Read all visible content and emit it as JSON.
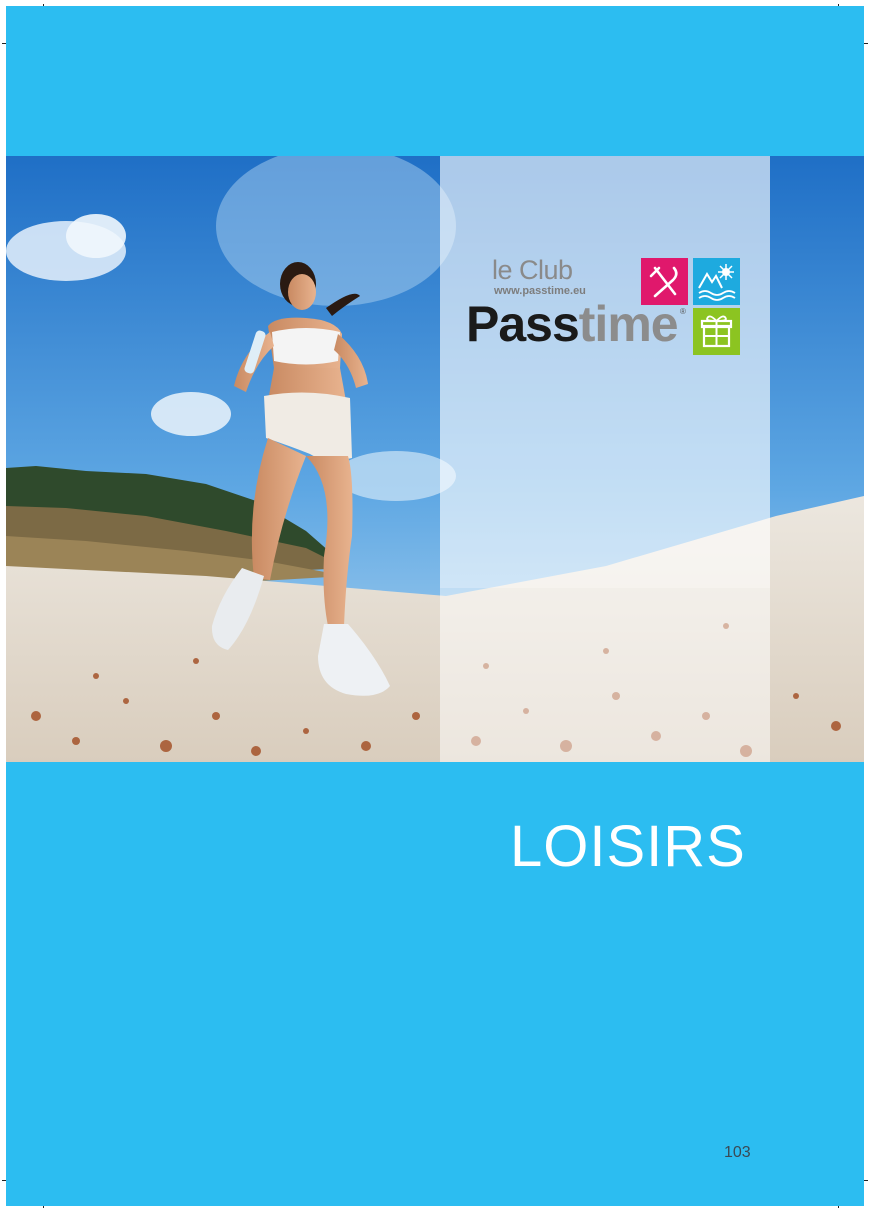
{
  "logo": {
    "prefix": "le Club",
    "website": "www.passtime.eu",
    "brand_dark": "Pass",
    "brand_light": "time",
    "registered": "®",
    "tile_colors": {
      "restaurant": "#e0186c",
      "leisure": "#1eaadf",
      "gift": "#8cc421"
    }
  },
  "section_title": "LOISIRS",
  "page_number": "103",
  "colors": {
    "page_background": "#2cbdf1"
  }
}
